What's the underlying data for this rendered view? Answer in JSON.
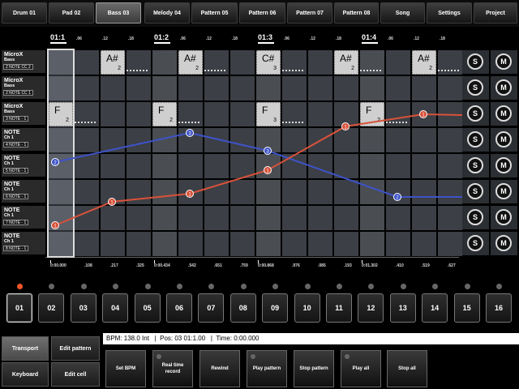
{
  "tabs": [
    "Drum 01",
    "Pad 02",
    "Bass 03",
    "Melody 04",
    "Pattern 05",
    "Pattern 06",
    "Pattern 07",
    "Pattern 08",
    "Song",
    "Settings",
    "Project"
  ],
  "active_tab": 2,
  "ruler": {
    "major": [
      "01:1",
      "01:2",
      "01:3",
      "01:4"
    ],
    "minor": [
      ".06",
      ".12",
      ".18"
    ]
  },
  "tracks": [
    {
      "name": "MicroX",
      "sub": "Bass",
      "box": "2 NOTE  CC 2"
    },
    {
      "name": "MicroX",
      "sub": "Bass",
      "box": "2 NOTE  CC 1"
    },
    {
      "name": "MicroX",
      "sub": "Bass",
      "box": "3 NOTE  -  1"
    },
    {
      "name": "NOTE",
      "sub": "Ch 1",
      "box": "4 NOTE  -  1"
    },
    {
      "name": "NOTE",
      "sub": "Ch 1",
      "box": "5 NOTE  -  1"
    },
    {
      "name": "NOTE",
      "sub": "Ch 1",
      "box": "6 NOTE  -  1"
    },
    {
      "name": "NOTE",
      "sub": "Ch 1",
      "box": "7 NOTE  -  1"
    },
    {
      "name": "NOTE",
      "sub": "Ch 1",
      "box": "8 NOTE  -  1"
    }
  ],
  "notes_row1": [
    {
      "name": "A#",
      "vel": "2"
    },
    {
      "name": "A#",
      "vel": "2"
    },
    {
      "name": "C#",
      "vel": "3"
    },
    {
      "name": "A#",
      "vel": "2"
    },
    {
      "name": "A#",
      "vel": "2"
    }
  ],
  "notes_row3": [
    {
      "name": "F",
      "vel": "2"
    },
    {
      "name": "F",
      "vel": "2"
    },
    {
      "name": "F",
      "vel": "3"
    },
    {
      "name": "F",
      "vel": "2"
    }
  ],
  "automation": {
    "blue": {
      "color": "#3e53c8",
      "points": [
        {
          "step": 0,
          "label": "2"
        },
        {
          "step": 5,
          "label": "3"
        },
        {
          "step": 8,
          "label": "3"
        },
        {
          "step": 13,
          "label": "2"
        }
      ]
    },
    "red": {
      "color": "#d8523a",
      "points": [
        {
          "step": 0,
          "label": "1"
        },
        {
          "step": 2,
          "label": "1"
        },
        {
          "step": 5,
          "label": "1"
        },
        {
          "step": 8,
          "label": "1"
        },
        {
          "step": 11,
          "label": "1"
        },
        {
          "step": 14,
          "label": "1"
        }
      ]
    }
  },
  "solo_label": "S",
  "mute_label": "M",
  "time_ruler": [
    "0:00.000",
    ".108",
    ".217",
    ".325",
    "0:00.434",
    ".542",
    ".651",
    ".759",
    "0:00.868",
    ".976",
    ".085",
    ".193",
    "0:01.302",
    ".410",
    ".519",
    ".627"
  ],
  "patterns": [
    "01",
    "02",
    "03",
    "04",
    "05",
    "06",
    "07",
    "08",
    "09",
    "10",
    "11",
    "12",
    "13",
    "14",
    "15",
    "16"
  ],
  "active_pattern": 0,
  "mode_buttons": [
    "Transport",
    "Edit pattern",
    "Keyboard",
    "Edit cell"
  ],
  "active_mode": 0,
  "status": {
    "bpm": "BPM: 138.0 Int",
    "pos": "Pos: 03 01:1.00",
    "time": "Time: 0:00.000"
  },
  "actions": [
    "Set BPM",
    "Real time record",
    "Rewind",
    "Play pattern",
    "Stop pattern",
    "Play all",
    "Stop all"
  ]
}
